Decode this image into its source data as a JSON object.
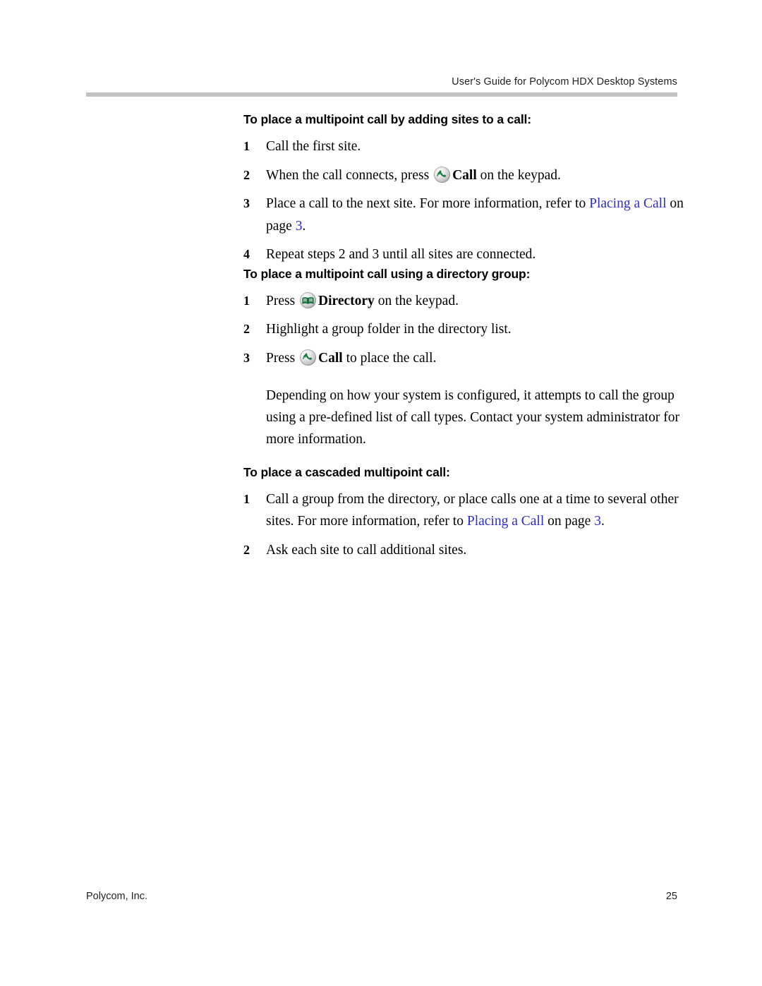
{
  "document": {
    "running_header": "User's Guide for Polycom HDX Desktop Systems",
    "footer_left": "Polycom, Inc.",
    "footer_page_number": "25",
    "link_color": "#2b2bd4",
    "rule_color": "#c3c3c3"
  },
  "sections": [
    {
      "heading": "To place a multipoint call by adding sites to a call:",
      "steps": [
        {
          "number": "1",
          "parts": [
            {
              "type": "text",
              "value": "Call the first site."
            }
          ]
        },
        {
          "number": "2",
          "parts": [
            {
              "type": "text",
              "value": "When the call connects, press "
            },
            {
              "type": "icon",
              "icon": "call-icon"
            },
            {
              "type": "bold",
              "value": "Call"
            },
            {
              "type": "text",
              "value": " on the keypad."
            }
          ]
        },
        {
          "number": "3",
          "parts": [
            {
              "type": "text",
              "value": "Place a call to the next site. For more information, refer to "
            },
            {
              "type": "link",
              "value": "Placing a Call"
            },
            {
              "type": "text",
              "value": " on page "
            },
            {
              "type": "link",
              "value": "3"
            },
            {
              "type": "text",
              "value": "."
            }
          ]
        },
        {
          "number": "4",
          "parts": [
            {
              "type": "text",
              "value": "Repeat steps 2 and 3 until all sites are connected."
            }
          ]
        }
      ]
    },
    {
      "heading": "To place a multipoint call using a directory group:",
      "steps": [
        {
          "number": "1",
          "parts": [
            {
              "type": "text",
              "value": "Press "
            },
            {
              "type": "icon",
              "icon": "directory-icon"
            },
            {
              "type": "bold",
              "value": "Directory"
            },
            {
              "type": "text",
              "value": " on the keypad."
            }
          ]
        },
        {
          "number": "2",
          "parts": [
            {
              "type": "text",
              "value": "Highlight a group folder in the directory list."
            }
          ]
        },
        {
          "number": "3",
          "parts": [
            {
              "type": "text",
              "value": "Press "
            },
            {
              "type": "icon",
              "icon": "call-icon"
            },
            {
              "type": "bold",
              "value": "Call"
            },
            {
              "type": "text",
              "value": " to place the call."
            }
          ]
        }
      ],
      "note": "Depending on how your system is configured, it attempts to call the group using a pre-defined list of call types. Contact your system administrator for more information."
    },
    {
      "heading": "To place a cascaded multipoint call:",
      "steps": [
        {
          "number": "1",
          "parts": [
            {
              "type": "text",
              "value": "Call a group from the directory, or place calls one at a time to several other sites. For more information, refer to "
            },
            {
              "type": "link",
              "value": "Placing a Call"
            },
            {
              "type": "text",
              "value": " on page "
            },
            {
              "type": "link",
              "value": "3"
            },
            {
              "type": "text",
              "value": "."
            }
          ]
        },
        {
          "number": "2",
          "parts": [
            {
              "type": "text",
              "value": "Ask each site to call additional sites."
            }
          ]
        }
      ]
    }
  ]
}
